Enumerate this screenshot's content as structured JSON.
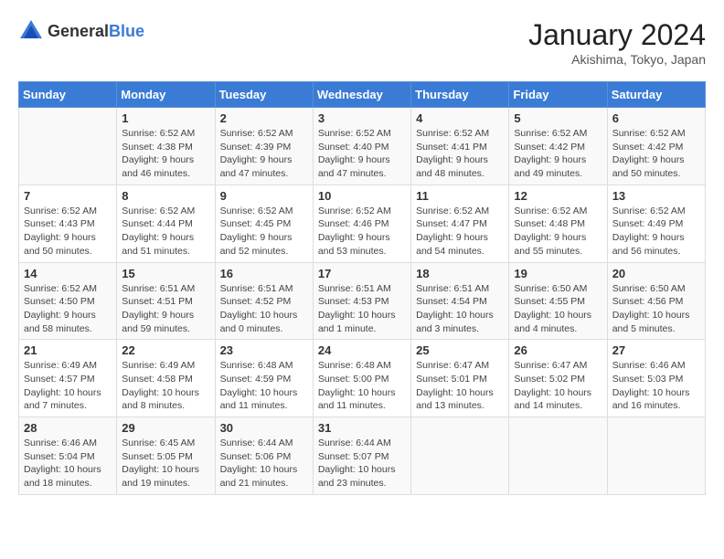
{
  "header": {
    "logo_general": "General",
    "logo_blue": "Blue",
    "month_title": "January 2024",
    "location": "Akishima, Tokyo, Japan"
  },
  "weekdays": [
    "Sunday",
    "Monday",
    "Tuesday",
    "Wednesday",
    "Thursday",
    "Friday",
    "Saturday"
  ],
  "weeks": [
    [
      {
        "day": "",
        "info": ""
      },
      {
        "day": "1",
        "info": "Sunrise: 6:52 AM\nSunset: 4:38 PM\nDaylight: 9 hours\nand 46 minutes."
      },
      {
        "day": "2",
        "info": "Sunrise: 6:52 AM\nSunset: 4:39 PM\nDaylight: 9 hours\nand 47 minutes."
      },
      {
        "day": "3",
        "info": "Sunrise: 6:52 AM\nSunset: 4:40 PM\nDaylight: 9 hours\nand 47 minutes."
      },
      {
        "day": "4",
        "info": "Sunrise: 6:52 AM\nSunset: 4:41 PM\nDaylight: 9 hours\nand 48 minutes."
      },
      {
        "day": "5",
        "info": "Sunrise: 6:52 AM\nSunset: 4:42 PM\nDaylight: 9 hours\nand 49 minutes."
      },
      {
        "day": "6",
        "info": "Sunrise: 6:52 AM\nSunset: 4:42 PM\nDaylight: 9 hours\nand 50 minutes."
      }
    ],
    [
      {
        "day": "7",
        "info": "Sunrise: 6:52 AM\nSunset: 4:43 PM\nDaylight: 9 hours\nand 50 minutes."
      },
      {
        "day": "8",
        "info": "Sunrise: 6:52 AM\nSunset: 4:44 PM\nDaylight: 9 hours\nand 51 minutes."
      },
      {
        "day": "9",
        "info": "Sunrise: 6:52 AM\nSunset: 4:45 PM\nDaylight: 9 hours\nand 52 minutes."
      },
      {
        "day": "10",
        "info": "Sunrise: 6:52 AM\nSunset: 4:46 PM\nDaylight: 9 hours\nand 53 minutes."
      },
      {
        "day": "11",
        "info": "Sunrise: 6:52 AM\nSunset: 4:47 PM\nDaylight: 9 hours\nand 54 minutes."
      },
      {
        "day": "12",
        "info": "Sunrise: 6:52 AM\nSunset: 4:48 PM\nDaylight: 9 hours\nand 55 minutes."
      },
      {
        "day": "13",
        "info": "Sunrise: 6:52 AM\nSunset: 4:49 PM\nDaylight: 9 hours\nand 56 minutes."
      }
    ],
    [
      {
        "day": "14",
        "info": "Sunrise: 6:52 AM\nSunset: 4:50 PM\nDaylight: 9 hours\nand 58 minutes."
      },
      {
        "day": "15",
        "info": "Sunrise: 6:51 AM\nSunset: 4:51 PM\nDaylight: 9 hours\nand 59 minutes."
      },
      {
        "day": "16",
        "info": "Sunrise: 6:51 AM\nSunset: 4:52 PM\nDaylight: 10 hours\nand 0 minutes."
      },
      {
        "day": "17",
        "info": "Sunrise: 6:51 AM\nSunset: 4:53 PM\nDaylight: 10 hours\nand 1 minute."
      },
      {
        "day": "18",
        "info": "Sunrise: 6:51 AM\nSunset: 4:54 PM\nDaylight: 10 hours\nand 3 minutes."
      },
      {
        "day": "19",
        "info": "Sunrise: 6:50 AM\nSunset: 4:55 PM\nDaylight: 10 hours\nand 4 minutes."
      },
      {
        "day": "20",
        "info": "Sunrise: 6:50 AM\nSunset: 4:56 PM\nDaylight: 10 hours\nand 5 minutes."
      }
    ],
    [
      {
        "day": "21",
        "info": "Sunrise: 6:49 AM\nSunset: 4:57 PM\nDaylight: 10 hours\nand 7 minutes."
      },
      {
        "day": "22",
        "info": "Sunrise: 6:49 AM\nSunset: 4:58 PM\nDaylight: 10 hours\nand 8 minutes."
      },
      {
        "day": "23",
        "info": "Sunrise: 6:48 AM\nSunset: 4:59 PM\nDaylight: 10 hours\nand 11 minutes."
      },
      {
        "day": "24",
        "info": "Sunrise: 6:48 AM\nSunset: 5:00 PM\nDaylight: 10 hours\nand 11 minutes."
      },
      {
        "day": "25",
        "info": "Sunrise: 6:47 AM\nSunset: 5:01 PM\nDaylight: 10 hours\nand 13 minutes."
      },
      {
        "day": "26",
        "info": "Sunrise: 6:47 AM\nSunset: 5:02 PM\nDaylight: 10 hours\nand 14 minutes."
      },
      {
        "day": "27",
        "info": "Sunrise: 6:46 AM\nSunset: 5:03 PM\nDaylight: 10 hours\nand 16 minutes."
      }
    ],
    [
      {
        "day": "28",
        "info": "Sunrise: 6:46 AM\nSunset: 5:04 PM\nDaylight: 10 hours\nand 18 minutes."
      },
      {
        "day": "29",
        "info": "Sunrise: 6:45 AM\nSunset: 5:05 PM\nDaylight: 10 hours\nand 19 minutes."
      },
      {
        "day": "30",
        "info": "Sunrise: 6:44 AM\nSunset: 5:06 PM\nDaylight: 10 hours\nand 21 minutes."
      },
      {
        "day": "31",
        "info": "Sunrise: 6:44 AM\nSunset: 5:07 PM\nDaylight: 10 hours\nand 23 minutes."
      },
      {
        "day": "",
        "info": ""
      },
      {
        "day": "",
        "info": ""
      },
      {
        "day": "",
        "info": ""
      }
    ]
  ]
}
